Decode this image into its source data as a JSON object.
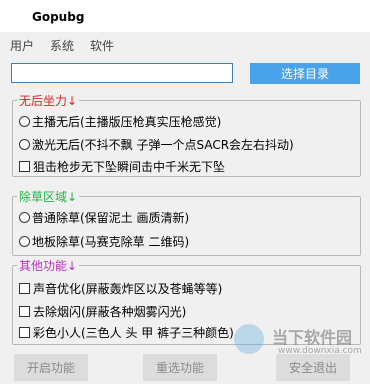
{
  "window": {
    "title": "Gopubg"
  },
  "menu": [
    "用户",
    "系统",
    "软件"
  ],
  "path_input": {
    "value": ""
  },
  "select_dir_button": "选择目录",
  "groups": {
    "recoil": {
      "label": "无后坐力↓",
      "label_color": "#e02020",
      "options": [
        {
          "type": "radio",
          "label": "主播无后(主播版压枪真实压枪感觉)"
        },
        {
          "type": "radio",
          "label": "激光无后(不抖不飘  子弹一个点SACR会左右抖动)"
        },
        {
          "type": "checkbox",
          "label": "狙击枪步无下坠瞬间击中千米无下坠"
        }
      ]
    },
    "grass": {
      "label": "除草区域↓",
      "label_color": "#22b34a",
      "options": [
        {
          "type": "radio",
          "label": "普通除草(保留泥土  画质清新)"
        },
        {
          "type": "radio",
          "label": "地板除草(马赛克除草  二维码)"
        }
      ]
    },
    "other": {
      "label": "其他功能↓",
      "label_color": "#c030c0",
      "options": [
        {
          "type": "checkbox",
          "label": "声音优化(屏蔽轰炸区以及苍蝇等等)"
        },
        {
          "type": "checkbox",
          "label": "去除烟闪(屏蔽各种烟雾闪光)"
        },
        {
          "type": "checkbox",
          "label": "彩色小人(三色人  头  甲  裤子三种颜色)"
        }
      ]
    }
  },
  "buttons": {
    "start": "开启功能",
    "reselect": "重选功能",
    "exit": "安全退出"
  },
  "watermark": {
    "brand": "当下软件园",
    "url": "www.downxia.com"
  }
}
